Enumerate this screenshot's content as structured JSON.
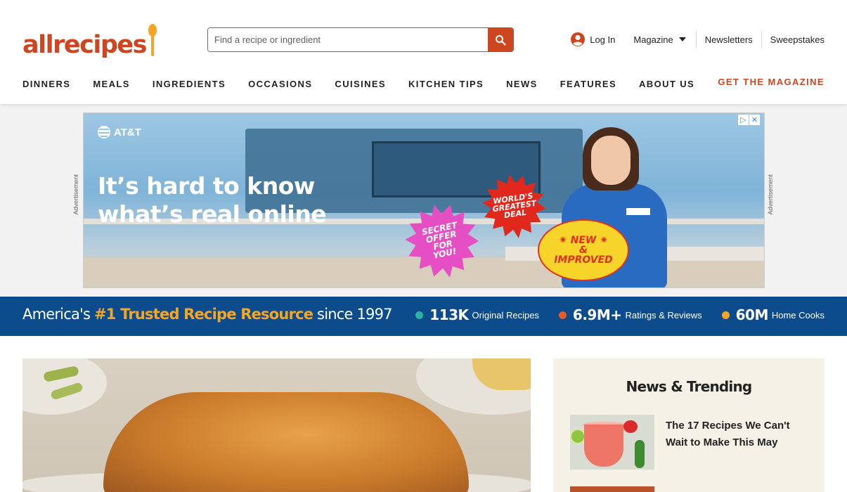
{
  "logo": {
    "text": "allrecipes"
  },
  "search": {
    "placeholder": "Find a recipe or ingredient"
  },
  "header_links": {
    "login": "Log In",
    "magazine": "Magazine",
    "newsletters": "Newsletters",
    "sweepstakes": "Sweepstakes"
  },
  "nav": {
    "items": [
      "DINNERS",
      "MEALS",
      "INGREDIENTS",
      "OCCASIONS",
      "CUISINES",
      "KITCHEN TIPS",
      "NEWS",
      "FEATURES",
      "ABOUT US"
    ],
    "cta": "GET THE MAGAZINE"
  },
  "ad": {
    "side_label": "Advertisement",
    "brand": "AT&T",
    "headline_1": "It’s hard to know",
    "headline_2": "what’s real online",
    "burst_offer": "SECRET OFFER FOR YOU!",
    "burst_deal": "WORLD'S GREATEST DEAL",
    "burst_new": "✷ NEW ✷\n&\nIMPROVED"
  },
  "trust": {
    "prefix": "America's ",
    "highlight": "#1 Trusted Recipe Resource",
    "suffix": " since 1997",
    "stats": [
      {
        "value": "113K",
        "label": "Original Recipes",
        "color": "#2bb3a0"
      },
      {
        "value": "6.9M+",
        "label": "Ratings & Reviews",
        "color": "#ea5b2a"
      },
      {
        "value": "60M",
        "label": "Home Cooks",
        "color": "#f5a623"
      }
    ]
  },
  "trending": {
    "heading": "News & Trending",
    "items": [
      {
        "title": "The 17 Recipes We Can't Wait to Make This May"
      }
    ]
  },
  "colors": {
    "brand": "#ce4620",
    "trust_band": "#0c4b8c",
    "trust_highlight": "#f5a623",
    "trending_bg": "#f5f1e6"
  }
}
